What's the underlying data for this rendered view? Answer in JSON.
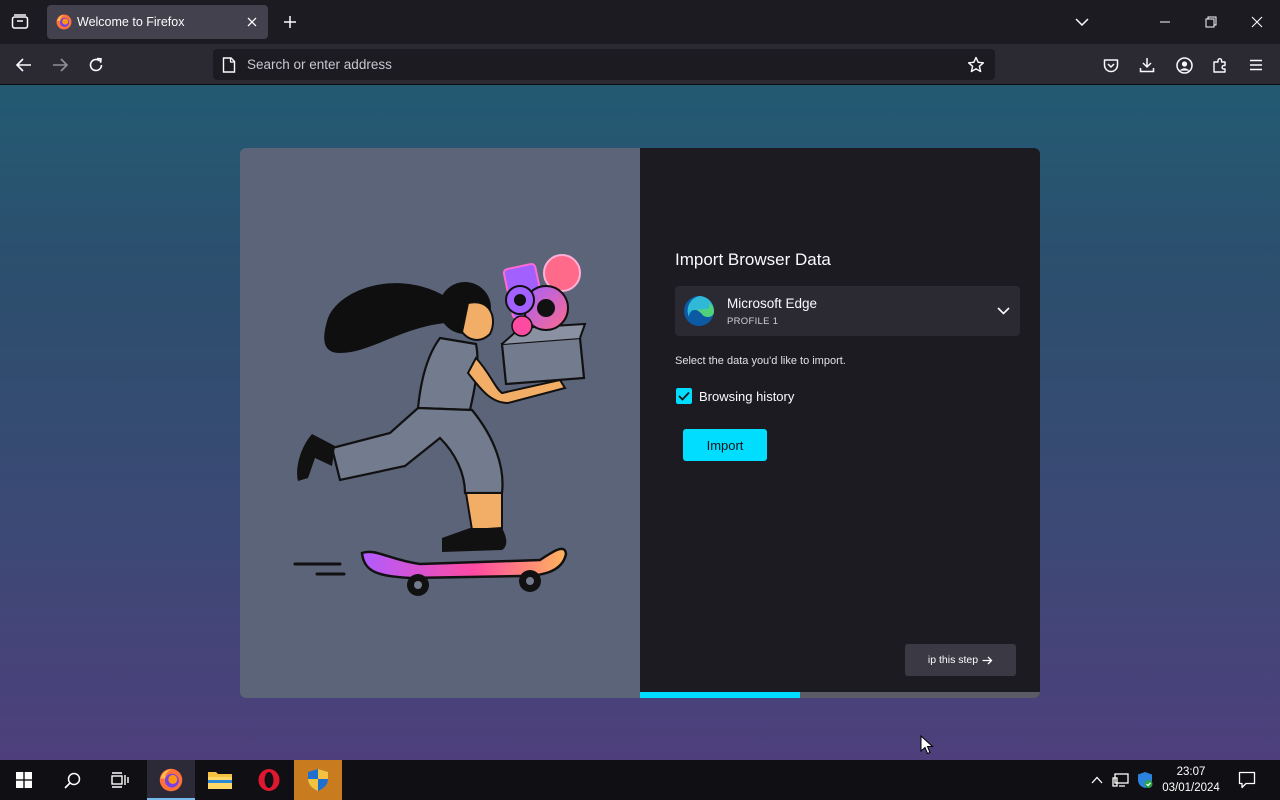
{
  "tab": {
    "title": "Welcome to Firefox"
  },
  "navbar": {
    "url_placeholder": "Search or enter address"
  },
  "dialog": {
    "title": "Import Browser Data",
    "browser": {
      "name": "Microsoft Edge",
      "profile": "PROFILE 1"
    },
    "hint": "Select the data you'd like to import.",
    "checkbox_label": "Browsing history",
    "checkbox_checked": true,
    "import_label": "Import",
    "skip_label": "ip this step",
    "progress_fraction": 0.4
  },
  "taskbar": {
    "time": "23:07",
    "date": "03/01/2024"
  },
  "colors": {
    "accent": "#00ddff",
    "toolbar": "#2b2a33",
    "tab_bg": "#1c1b22",
    "illustration_bg": "#5b6479"
  }
}
